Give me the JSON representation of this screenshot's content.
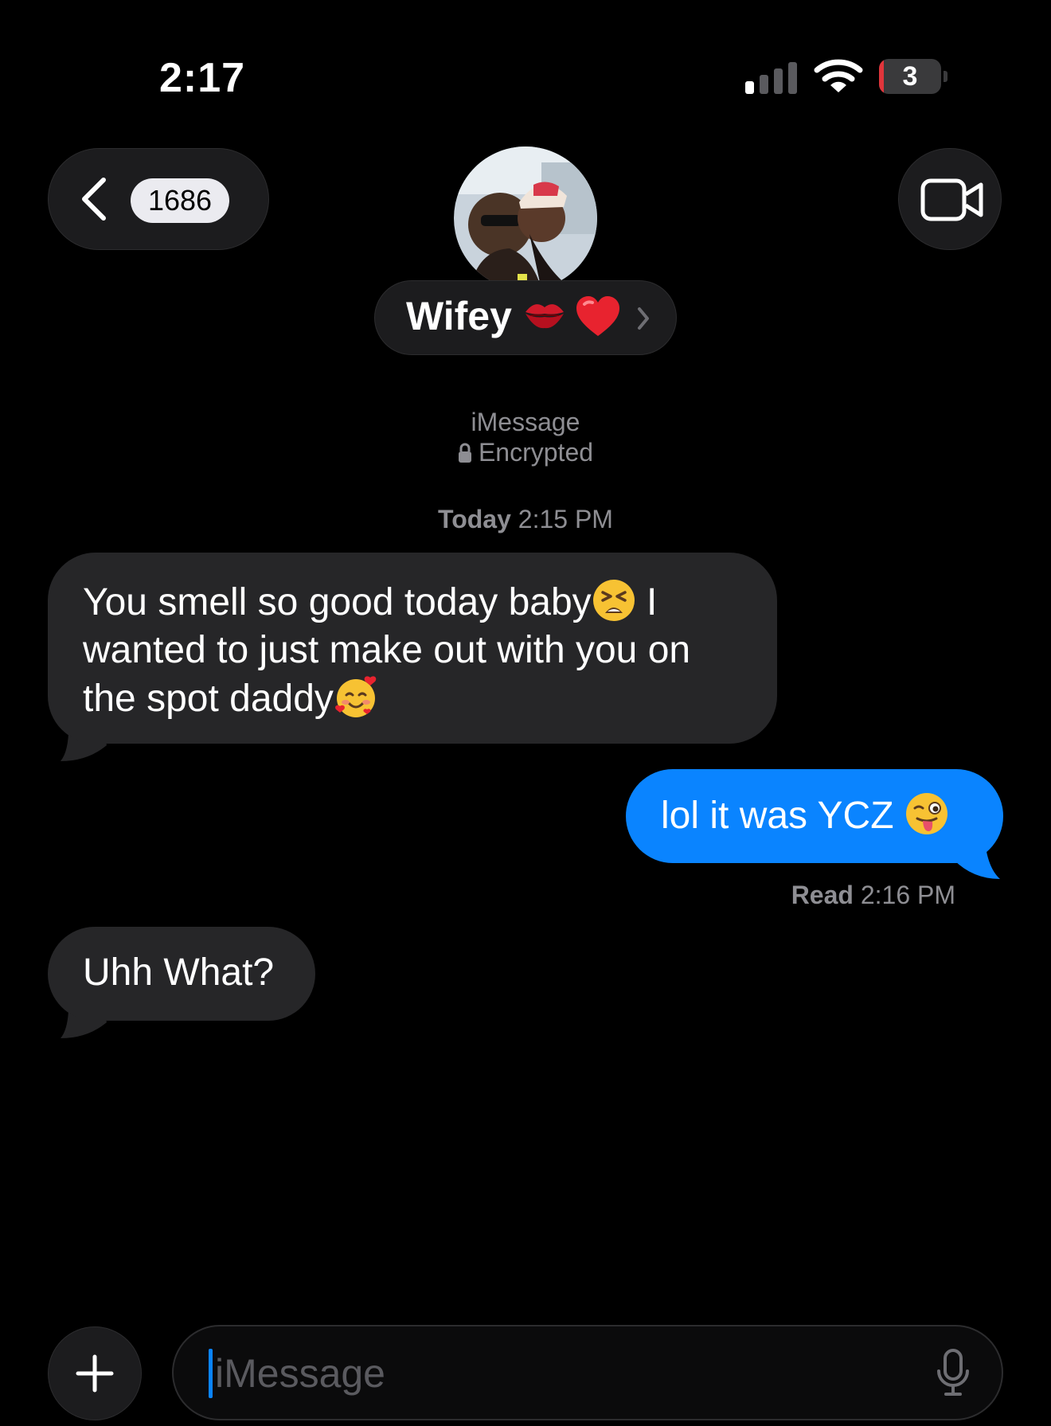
{
  "status_bar": {
    "time": "2:17",
    "battery_level": "3",
    "battery_percent": 3,
    "signal_bars": 1
  },
  "header": {
    "back_count": "1686",
    "contact_name": "Wifey",
    "name_emojis": [
      "kiss-mark-icon",
      "red-heart-icon"
    ],
    "video_call_icon": "video-camera-icon"
  },
  "conversation": {
    "service": "iMessage",
    "encryption": "Encrypted",
    "timestamp_day": "Today",
    "timestamp_time": "2:15 PM",
    "messages": [
      {
        "direction": "incoming",
        "line1_a": "You smell so good today baby",
        "emoji1": "tired-face-emoji",
        "line1_b": " I",
        "line2": "wanted to just make out with you on",
        "line3": "the spot daddy",
        "emoji2": "smiling-face-with-hearts-emoji"
      },
      {
        "direction": "outgoing",
        "text": "lol it was YCZ ",
        "emoji": "winking-face-with-tongue-emoji"
      },
      {
        "direction": "incoming",
        "text": "Uhh What?"
      }
    ],
    "read_label": "Read",
    "read_time": "2:16 PM"
  },
  "composer": {
    "placeholder": "iMessage"
  },
  "colors": {
    "background": "#000000",
    "incoming_bubble": "#262628",
    "outgoing_bubble": "#0a84ff",
    "secondary_text": "#8e8e93",
    "battery_low": "#e0353b"
  }
}
